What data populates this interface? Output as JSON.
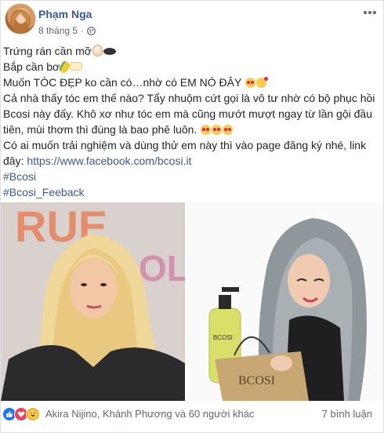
{
  "post": {
    "author": "Phạm Nga",
    "date": "8 tháng 5",
    "dot": "·",
    "lines": {
      "l1": "Trứng rán cần mỡ",
      "l2": "Bắp cần bơ",
      "l3": "Muốn TÓC ĐẸP ko cần có…nhờ có EM NÓ ĐÂY",
      "l4": "Cả nhà thấy tóc em thế nào? Tẩy nhuộm cứt gọi là vô tư nhờ có bộ phục hồi Bcosi này đấy. Khô xơ như tóc em mà cũng mướt mượt ngay từ lần gội đầu tiên, mùi thơm thì đúng là bao phê luôn.",
      "l5": "Có ai muốn trải nghiệm và dùng thử em này thì vào page đăng ký nhé, link đây:",
      "link": "https://www.facebook.com/bcosi.it",
      "tag1": "#Bcosi",
      "tag2": "#Bcosi_Feeback"
    },
    "photo_text": {
      "left_brand": "RUE",
      "left_brand2": "OL",
      "bottle_label": "BCOSI",
      "bag_label": "BCOSI"
    }
  },
  "footer": {
    "reactions": [
      "like",
      "love",
      "haha"
    ],
    "reaction_text": "Akira Nijino, Khánh Phương và 60 người khác",
    "comments": "7 bình luận"
  },
  "colors": {
    "link": "#385898",
    "meta": "#616770",
    "like": "#1877f2",
    "love": "#f33e58",
    "haha": "#f7b125"
  }
}
